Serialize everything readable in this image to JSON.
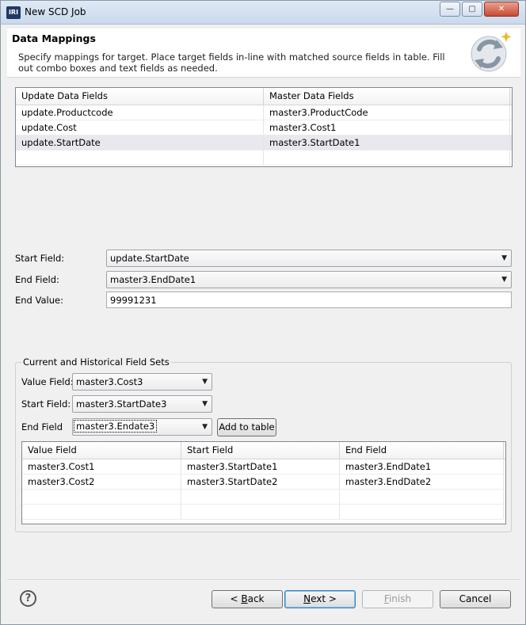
{
  "window": {
    "app_icon_text": "IRI",
    "title": "New SCD Job",
    "minimize_glyph": "—",
    "maximize_glyph": "▢",
    "close_glyph": "✕"
  },
  "header": {
    "title": "Data Mappings",
    "description": "Specify mappings for target. Place target fields in-line with matched source fields in table. Fill out combo boxes and text fields as needed."
  },
  "mapping_table": {
    "columns": [
      "Update Data Fields",
      "Master Data Fields"
    ],
    "rows": [
      [
        "update.Productcode",
        "master3.ProductCode"
      ],
      [
        "update.Cost",
        "master3.Cost1"
      ],
      [
        "update.StartDate",
        "master3.StartDate1"
      ],
      [
        "",
        ""
      ]
    ]
  },
  "form": {
    "start_field_label": "Start Field:",
    "start_field_value": "update.StartDate",
    "end_field_label": "End Field:",
    "end_field_value": "master3.EndDate1",
    "end_value_label": "End Value:",
    "end_value_value": "99991231"
  },
  "field_sets": {
    "group_title": "Current and Historical Field Sets",
    "value_field_label": "Value Field:",
    "value_field_value": "master3.Cost3",
    "start_field_label": "Start Field:",
    "start_field_value": "master3.StartDate3",
    "end_field_label": "End Field",
    "end_field_value": "master3.Endate3",
    "add_button_label": "Add to table",
    "table": {
      "columns": [
        "Value Field",
        "Start Field",
        "End Field"
      ],
      "rows": [
        [
          "master3.Cost1",
          "master3.StartDate1",
          "master3.EndDate1"
        ],
        [
          "master3.Cost2",
          "master3.StartDate2",
          "master3.EndDate2"
        ],
        [
          "",
          "",
          ""
        ],
        [
          "",
          "",
          ""
        ]
      ]
    }
  },
  "footer": {
    "help_glyph": "?",
    "back_prefix": "< ",
    "back_mnemonic": "B",
    "back_rest": "ack",
    "next_mnemonic": "N",
    "next_rest": "ext >",
    "finish_mnemonic": "F",
    "finish_rest": "inish",
    "cancel_label": "Cancel"
  },
  "icons": {
    "dropdown_arrow": "▼"
  }
}
